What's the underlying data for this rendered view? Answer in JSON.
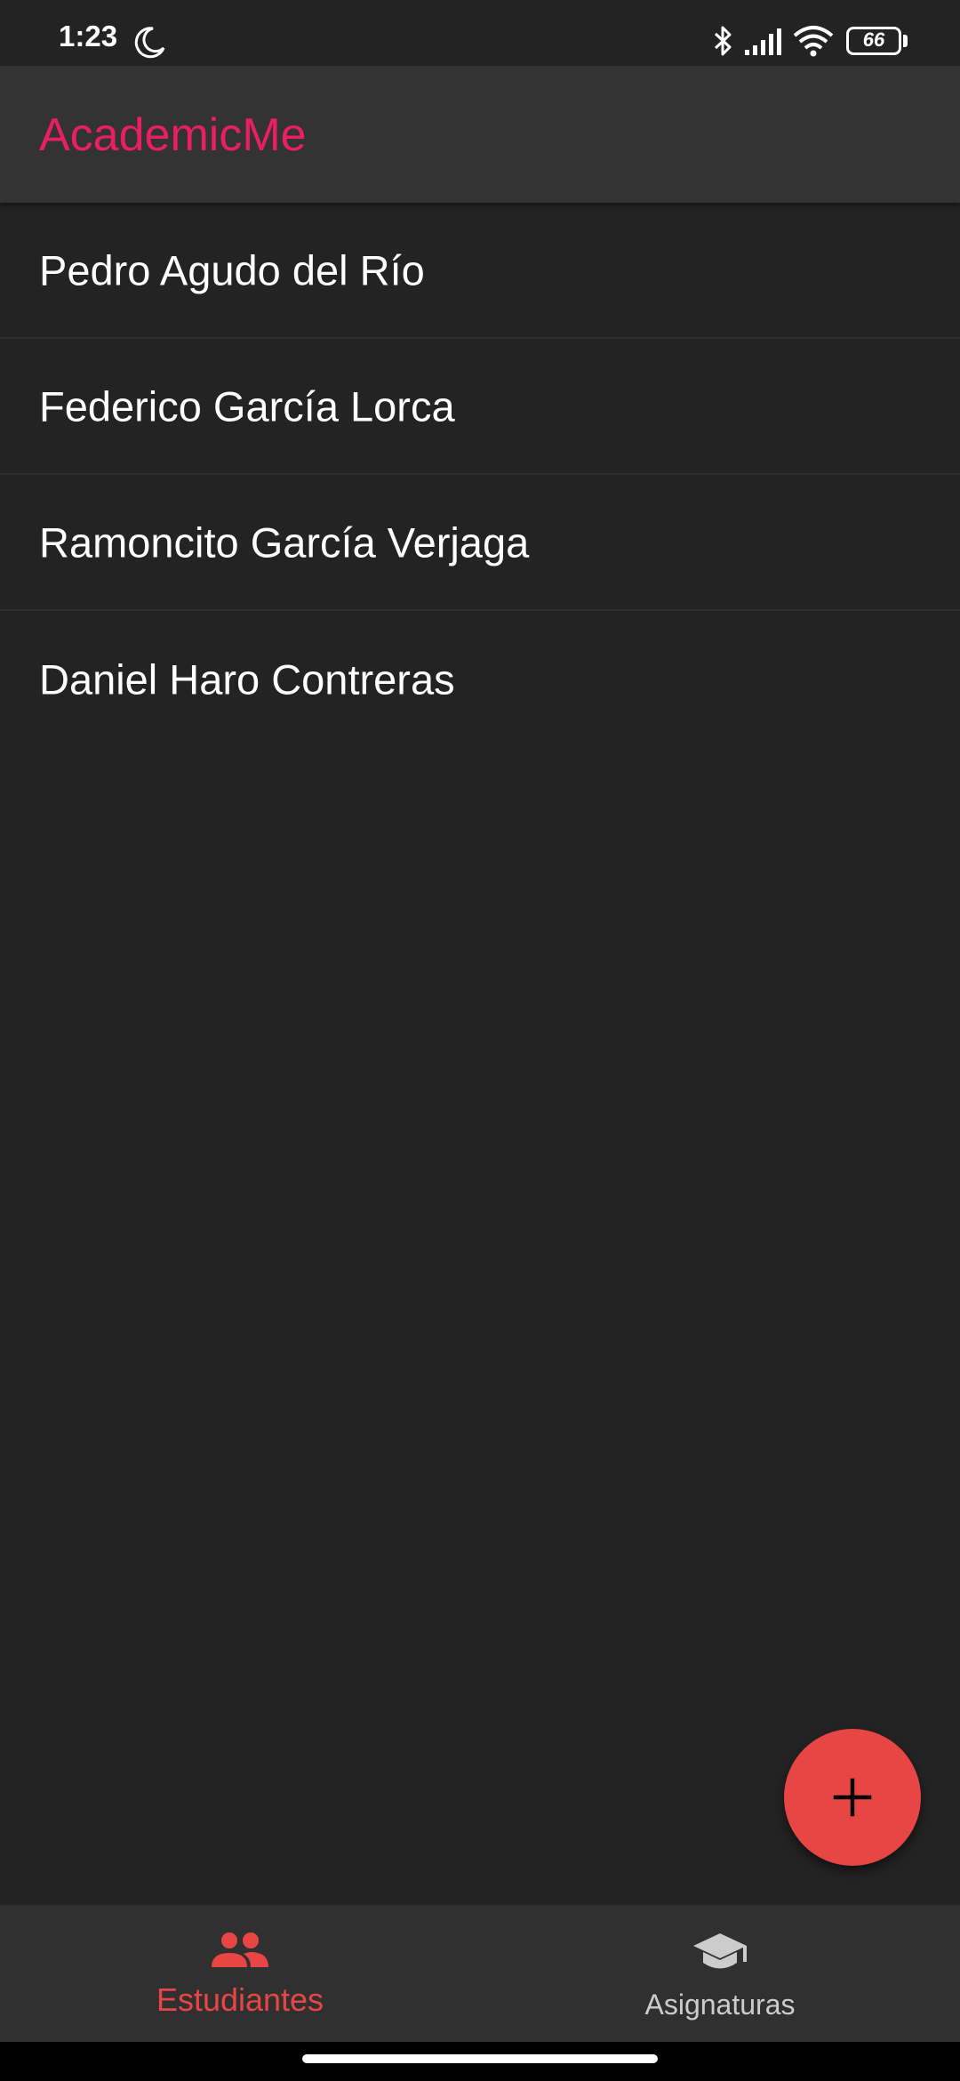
{
  "status_bar": {
    "time": "1:23",
    "battery": "66",
    "icons": [
      "moon-icon",
      "bluetooth-icon",
      "signal-icon",
      "wifi-icon",
      "battery-icon"
    ]
  },
  "app_bar": {
    "title": "AcademicMe",
    "title_color": "#e91e63"
  },
  "students": [
    {
      "name": "Pedro Agudo del Río"
    },
    {
      "name": "Federico García Lorca"
    },
    {
      "name": "Ramoncito García Verjaga"
    },
    {
      "name": "Daniel Haro Contreras"
    }
  ],
  "fab": {
    "icon": "plus-icon",
    "color": "#e84545"
  },
  "bottom_nav": {
    "items": [
      {
        "label": "Estudiantes",
        "icon": "people-icon",
        "active": true,
        "color": "#e84545"
      },
      {
        "label": "Asignaturas",
        "icon": "school-icon",
        "active": false,
        "color": "#cccccc"
      }
    ]
  },
  "colors": {
    "background": "#232323",
    "app_bar": "#333333",
    "bottom_nav": "#303030",
    "accent": "#e84545"
  }
}
